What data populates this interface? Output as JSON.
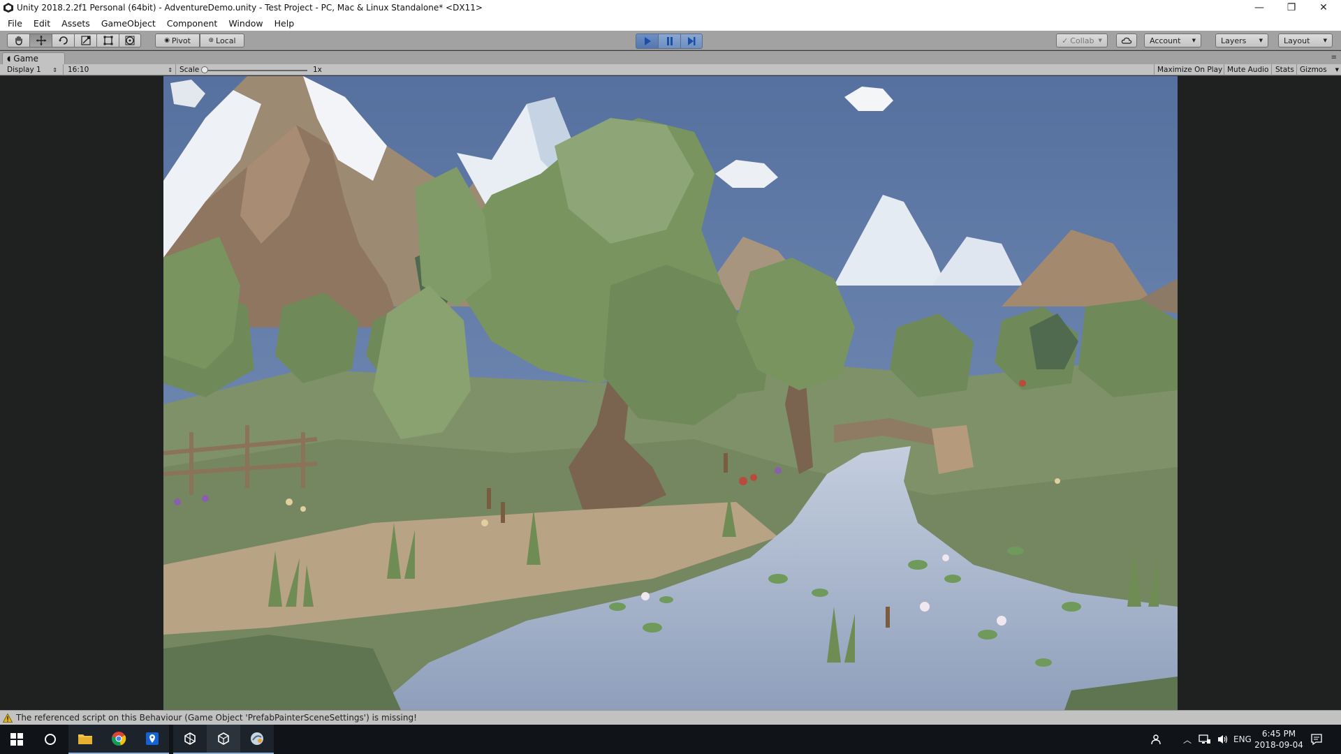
{
  "window": {
    "title": "Unity 2018.2.2f1 Personal (64bit) - AdventureDemo.unity - Test Project - PC, Mac & Linux Standalone* <DX11>",
    "minimize": "—",
    "restore": "❐",
    "close": "✕"
  },
  "menu": [
    "File",
    "Edit",
    "Assets",
    "GameObject",
    "Component",
    "Window",
    "Help"
  ],
  "toolbar": {
    "tools": [
      "hand-tool",
      "move-tool",
      "rotate-tool",
      "scale-tool",
      "rect-tool",
      "transform-tool"
    ],
    "active_tool": "move-tool",
    "pivot_label": "Pivot",
    "local_label": "Local",
    "collab_label": "Collab",
    "account_label": "Account",
    "layers_label": "Layers",
    "layout_label": "Layout",
    "play_state": "playing"
  },
  "game_tab": {
    "label": "Game",
    "display": "Display 1",
    "aspect": "16:10",
    "scale_label": "Scale",
    "scale_value": "1x",
    "scale_slider": 0.0,
    "maximize_on_play": "Maximize On Play",
    "mute_audio": "Mute Audio",
    "stats": "Stats",
    "gizmos": "Gizmos"
  },
  "status": {
    "message": "The referenced script on this Behaviour (Game Object 'PrefabPainterSceneSettings') is missing!"
  },
  "taskbar": {
    "apps": [
      "start-icon",
      "cortana-icon",
      "file-explorer-icon",
      "chrome-icon",
      "maps-icon",
      "unity-hub-icon",
      "unity-editor-icon",
      "app-icon"
    ],
    "language": "ENG",
    "time": "6:45 PM",
    "date": "2018-09-04"
  },
  "colors": {
    "sky": "#5d7aa8",
    "grass": "#7d9266",
    "water": "#a9b6cc",
    "tree": "#7a9460"
  }
}
